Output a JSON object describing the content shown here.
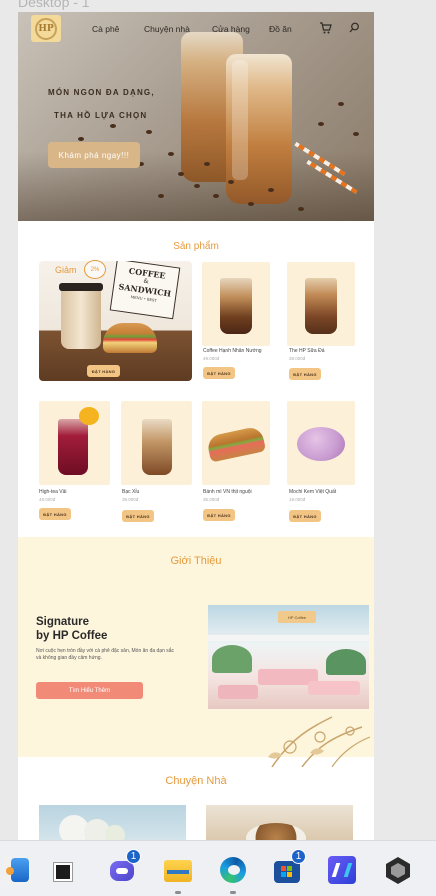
{
  "canvas": {
    "frame_label": "Desktop - 1"
  },
  "nav": {
    "logo_text": "HP",
    "items": [
      "Cà phê",
      "Chuyện nhà",
      "Cửa hàng",
      "Đồ ăn"
    ],
    "icons": [
      "cart-icon",
      "search-icon"
    ]
  },
  "hero": {
    "line1": "MÓN NGON ĐA DẠNG,",
    "line2": "THA HỒ LỰA CHỌN",
    "cta": "Khám phá ngay!!!"
  },
  "products": {
    "title": "Sản phẩm",
    "featured": {
      "discount_label": "Giảm",
      "discount_value": "2%",
      "sign_line1": "COFFEE",
      "sign_line2": "&",
      "sign_line3": "SANDWICH",
      "sign_line4": "MENU • BEST",
      "order_label": "ĐẶT HÀNG"
    },
    "row1": [
      {
        "name": "Coffee Hạnh Nhân Nướng",
        "price": "49.000đ",
        "order": "ĐẶT HÀNG"
      },
      {
        "name": "The HP Sữa Đá",
        "price": "39.000đ",
        "order": "ĐẶT HÀNG"
      }
    ],
    "row2": [
      {
        "name": "High-tea Vải",
        "price": "49.000đ",
        "order": "ĐẶT HÀNG"
      },
      {
        "name": "Bạc Xỉu",
        "price": "39.000đ",
        "order": "ĐẶT HÀNG"
      },
      {
        "name": "Bánh mì VN thịt nguội",
        "price": "35.000đ",
        "order": "ĐẶT HÀNG"
      },
      {
        "name": "Mochi Kem Việt Quất",
        "price": "19.000đ",
        "order": "ĐẶT HÀNG"
      }
    ]
  },
  "about": {
    "title": "Giới Thiệu",
    "heading_line1": "Signature",
    "heading_line2": "by HP Coffee",
    "text": "Nơi cuộc hẹn tròn đầy với cà phê đặc sản, Món ăn đa dạn sắc và không gian đầy cảm hứng.",
    "button": "Tìm Hiểu Thêm",
    "photo_sign": "HP Coffee"
  },
  "house": {
    "title": "Chuyện Nhà"
  },
  "taskbar": {
    "apps": [
      {
        "name": "files-app",
        "badge": ""
      },
      {
        "name": "task-view",
        "badge": ""
      },
      {
        "name": "chat-app",
        "badge": "1"
      },
      {
        "name": "file-explorer",
        "badge": ""
      },
      {
        "name": "edge-browser",
        "badge": ""
      },
      {
        "name": "store-app",
        "badge": "1"
      },
      {
        "name": "editor-app",
        "badge": ""
      },
      {
        "name": "unity-app",
        "badge": ""
      }
    ]
  },
  "colors": {
    "accent": "#e69a3c",
    "button": "#f3c584",
    "about_bg": "#fdf6dd",
    "coral": "#f18b78"
  }
}
